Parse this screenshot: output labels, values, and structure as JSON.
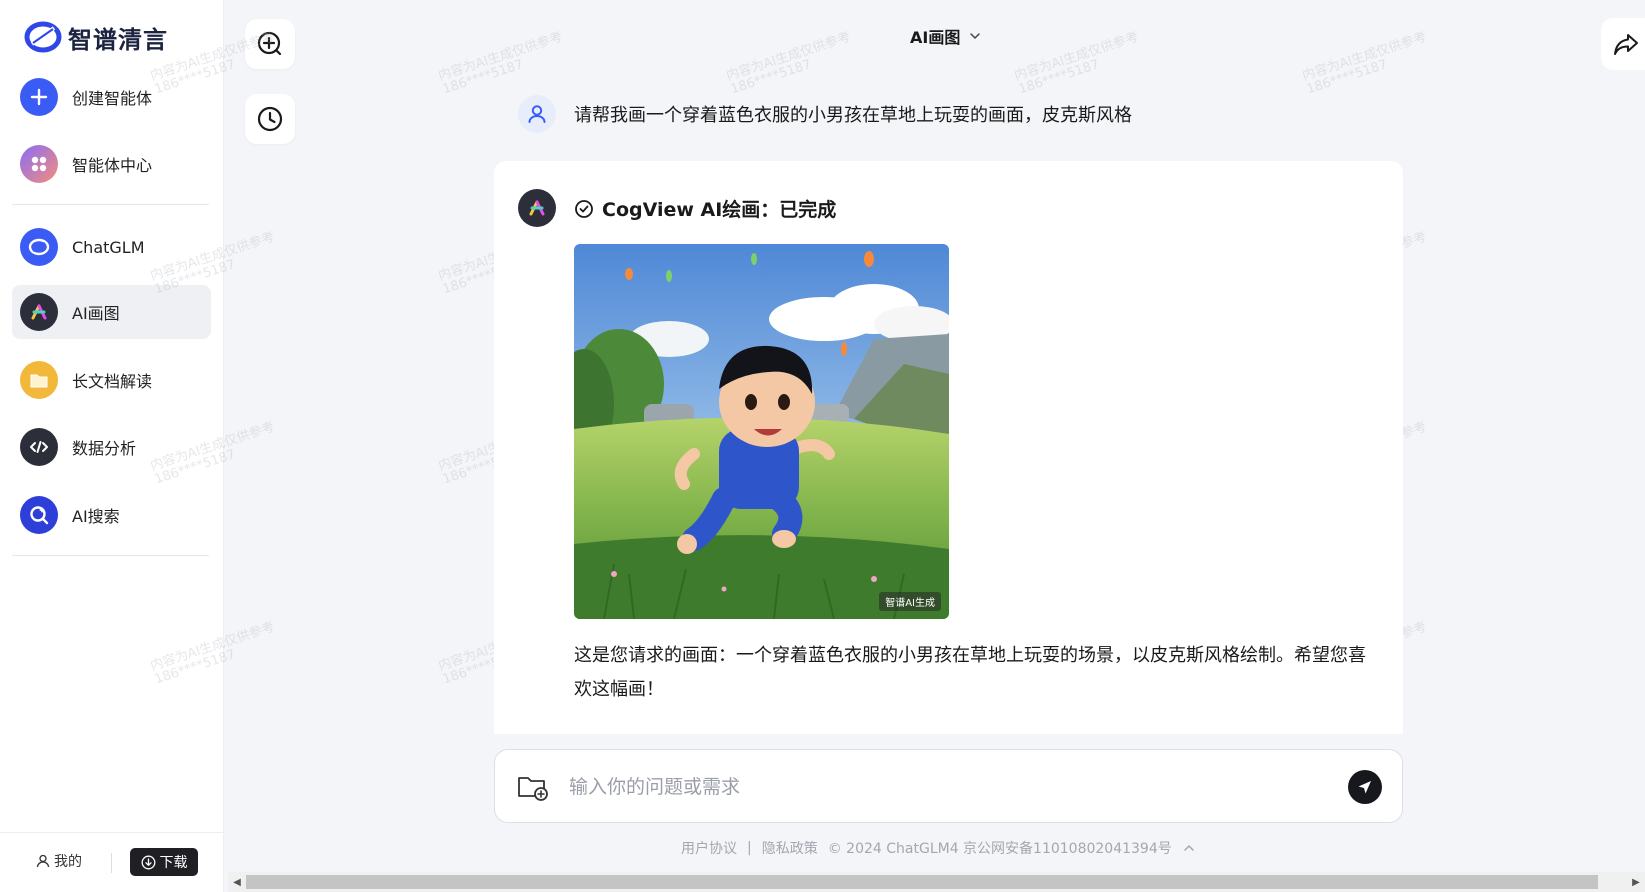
{
  "brand": {
    "name": "智谱清言"
  },
  "sidebar": {
    "items": [
      {
        "label": "创建智能体",
        "icon": "plus-icon",
        "color": "#3b5bf5"
      },
      {
        "label": "智能体中心",
        "icon": "apps-icon",
        "color": "#7b6cf6"
      },
      {
        "label": "ChatGLM",
        "icon": "chatglm-icon",
        "color": "#3b5bf5"
      },
      {
        "label": "AI画图",
        "icon": "paint-icon",
        "color": "#2c2f3a"
      },
      {
        "label": "长文档解读",
        "icon": "folder-icon",
        "color": "#f2b83a"
      },
      {
        "label": "数据分析",
        "icon": "code-icon",
        "color": "#2c2f3a"
      },
      {
        "label": "AI搜索",
        "icon": "search-icon",
        "color": "#2d3fd8"
      }
    ],
    "active_index": 3,
    "footer": {
      "me_label": "我的",
      "download_label": "下载"
    }
  },
  "header": {
    "model_label": "AI画图"
  },
  "watermark": {
    "line1": "内容为AI生成仅供参考",
    "line2": "186****5187"
  },
  "chat": {
    "user_message": "请帮我画一个穿着蓝色衣服的小男孩在草地上玩耍的画面，皮克斯风格",
    "assistant": {
      "status": "CogView AI绘画：已完成",
      "image_badge": "智谱AI生成",
      "text": "这是您请求的画面：一个穿着蓝色衣服的小男孩在草地上玩耍的场景，以皮克斯风格绘制。希望您喜欢这幅画！"
    }
  },
  "input": {
    "placeholder": "输入你的问题或需求",
    "value": ""
  },
  "footer": {
    "terms": "用户协议",
    "sep": "|",
    "privacy": "隐私政策",
    "copyright": "© 2024 ChatGLM4 京公网安备11010802041394号"
  }
}
